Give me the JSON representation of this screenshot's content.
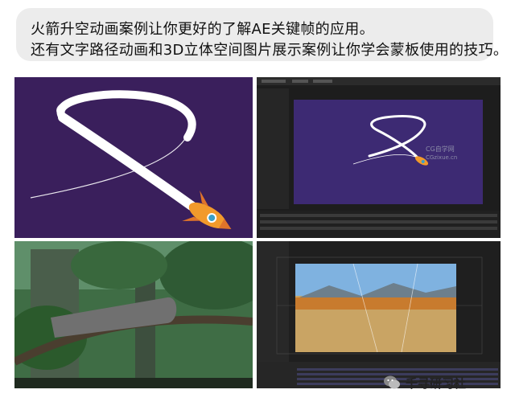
{
  "caption": {
    "line1": "火箭升空动画案例让你更好的了解AE关键帧的应用。",
    "line2": "还有文字路径动画和3D立体空间图片展示案例让你学会蒙板使用的技巧。"
  },
  "panels": {
    "rocket_demo": {
      "background": "#3a1f5c"
    },
    "ae_rocket": {
      "watermark_line1": "CG自学网",
      "watermark_line2": "CGzixue.cn",
      "comp_background": "#3d2a73"
    },
    "forest_demo": {},
    "ae_3d_photo": {}
  },
  "watermark": {
    "text": "千寻研习社"
  }
}
